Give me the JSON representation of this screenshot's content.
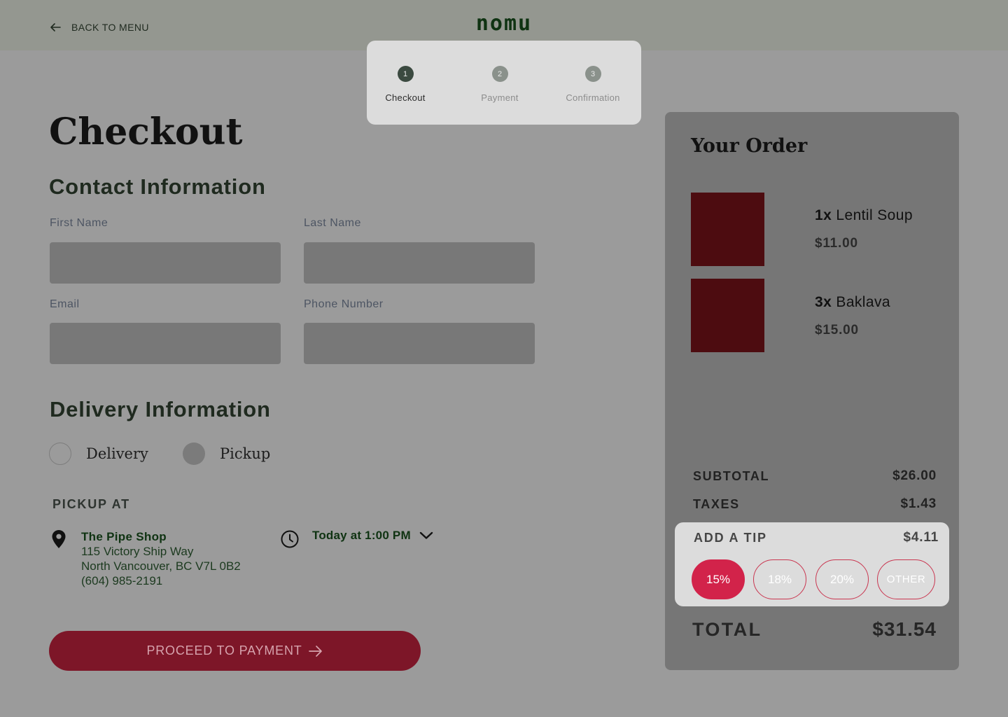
{
  "header": {
    "back_label": "BACK TO MENU",
    "logo": "nomu"
  },
  "stepper": {
    "steps": [
      {
        "number": "1",
        "label": "Checkout",
        "state": "active"
      },
      {
        "number": "2",
        "label": "Payment",
        "state": "inactive"
      },
      {
        "number": "3",
        "label": "Confirmation",
        "state": "inactive"
      }
    ]
  },
  "checkout": {
    "title": "Checkout",
    "contact": {
      "heading": "Contact Information",
      "first_name_label": "First Name",
      "first_name_value": "",
      "last_name_label": "Last Name",
      "last_name_value": "",
      "email_label": "Email",
      "email_value": "",
      "phone_label": "Phone Number",
      "phone_value": ""
    },
    "delivery": {
      "heading": "Delivery Information",
      "options": [
        {
          "label": "Delivery",
          "selected": false
        },
        {
          "label": "Pickup",
          "selected": true
        }
      ]
    },
    "pickup": {
      "heading": "PICKUP AT",
      "shop_name": "The Pipe Shop",
      "address_line1": "115 Victory Ship Way",
      "address_line2": "North Vancouver, BC V7L 0B2",
      "phone": "(604) 985-2191",
      "time": "Today at 1:00 PM"
    },
    "proceed_label": "PROCEED TO PAYMENT"
  },
  "order": {
    "title": "Your Order",
    "items": [
      {
        "qty": "1x",
        "name": "Lentil Soup",
        "price": "$11.00"
      },
      {
        "qty": "3x",
        "name": "Baklava",
        "price": "$15.00"
      }
    ],
    "subtotal_label": "SUBTOTAL",
    "subtotal_value": "$26.00",
    "taxes_label": "TAXES",
    "taxes_value": "$1.43",
    "tip": {
      "label": "ADD A TIP",
      "value": "$4.11",
      "options": [
        "15%",
        "18%",
        "20%",
        "OTHER"
      ],
      "selected": "15%"
    },
    "total_label": "TOTAL",
    "total_value": "$31.54"
  },
  "colors": {
    "accent": "#d2234a",
    "button": "#7d1628",
    "brand": "#0f3312",
    "item_thumb": "#4d0c10"
  }
}
